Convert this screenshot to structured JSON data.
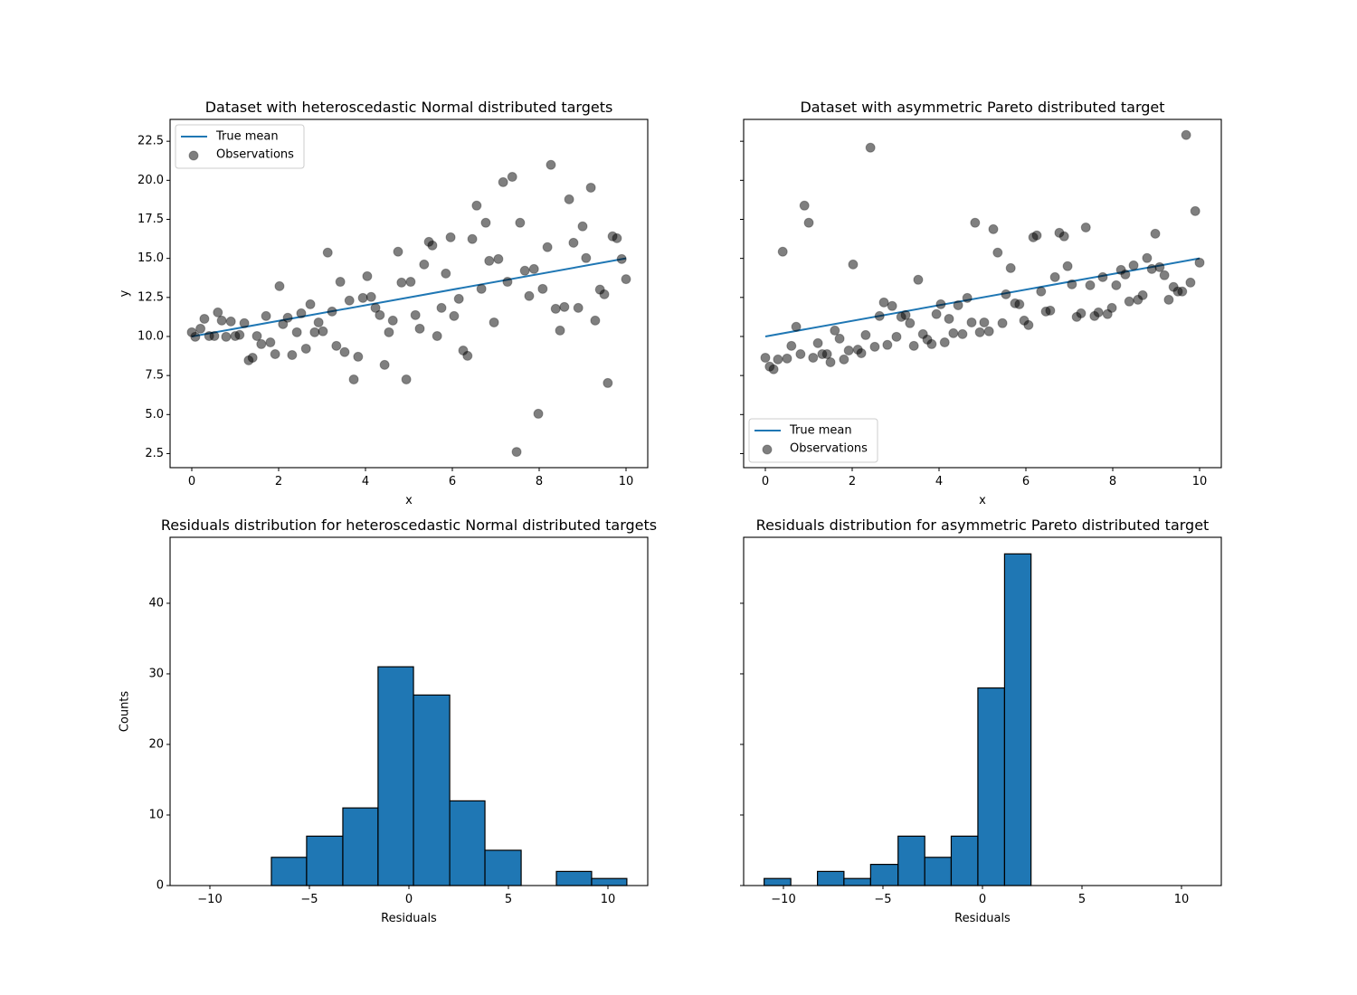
{
  "chart_data": [
    {
      "type": "scatter",
      "title": "Dataset with heteroscedastic Normal distributed targets",
      "xlabel": "x",
      "ylabel": "y",
      "xlim": [
        -0.5,
        10.5
      ],
      "ylim": [
        1.6,
        23.9
      ],
      "xticks": [
        0,
        2,
        4,
        6,
        8,
        10
      ],
      "xtick_labels": [
        "0",
        "2",
        "4",
        "6",
        "8",
        "10"
      ],
      "yticks": [
        2.5,
        5.0,
        7.5,
        10.0,
        12.5,
        15.0,
        17.5,
        20.0,
        22.5
      ],
      "ytick_labels": [
        "2.5",
        "5.0",
        "7.5",
        "10.0",
        "12.5",
        "15.0",
        "17.5",
        "20.0",
        "22.5"
      ],
      "show_ytick_labels": true,
      "legend": {
        "placement": "upper-left",
        "entries": [
          "True mean",
          "Observations"
        ]
      },
      "grid": false,
      "true_mean": {
        "name": "True mean",
        "x": [
          0,
          10
        ],
        "y": [
          10,
          15
        ],
        "color": "#1f77b4"
      },
      "observations": {
        "name": "Observations",
        "color": "#000000",
        "alpha": 0.5,
        "x": [
          0,
          0.08,
          0.2,
          0.29,
          0.4,
          0.52,
          0.6,
          0.69,
          0.79,
          0.9,
          1.0,
          1.1,
          1.21,
          1.31,
          1.4,
          1.5,
          1.6,
          1.71,
          1.81,
          1.92,
          2.02,
          2.1,
          2.21,
          2.31,
          2.42,
          2.52,
          2.63,
          2.73,
          2.83,
          2.92,
          3.02,
          3.13,
          3.23,
          3.33,
          3.42,
          3.52,
          3.63,
          3.73,
          3.83,
          3.94,
          4.04,
          4.13,
          4.23,
          4.33,
          4.44,
          4.54,
          4.63,
          4.75,
          4.83,
          4.94,
          5.04,
          5.15,
          5.25,
          5.35,
          5.46,
          5.54,
          5.65,
          5.75,
          5.85,
          5.96,
          6.04,
          6.15,
          6.25,
          6.35,
          6.46,
          6.56,
          6.67,
          6.77,
          6.85,
          6.96,
          7.06,
          7.17,
          7.27,
          7.38,
          7.48,
          7.56,
          7.67,
          7.77,
          7.88,
          7.98,
          8.08,
          8.19,
          8.27,
          8.38,
          8.48,
          8.58,
          8.69,
          8.79,
          8.9,
          9.0,
          9.08,
          9.19,
          9.29,
          9.4,
          9.5,
          9.58,
          9.69,
          9.79,
          9.9,
          10
        ],
        "y": [
          10.27,
          9.98,
          10.5,
          11.13,
          10.03,
          10.03,
          11.54,
          11.02,
          9.98,
          10.96,
          10.03,
          10.1,
          10.85,
          8.47,
          8.64,
          10.03,
          9.51,
          11.31,
          9.62,
          8.87,
          13.22,
          10.79,
          11.2,
          8.81,
          10.27,
          11.48,
          9.22,
          12.06,
          10.27,
          10.9,
          10.33,
          15.37,
          11.6,
          9.4,
          13.5,
          9.0,
          12.3,
          7.25,
          8.7,
          12.47,
          13.86,
          12.53,
          11.83,
          11.37,
          8.18,
          10.27,
          11.02,
          15.43,
          13.45,
          7.25,
          13.5,
          11.37,
          10.5,
          14.61,
          16.06,
          15.83,
          10.03,
          11.83,
          14.03,
          16.35,
          11.31,
          12.41,
          9.1,
          8.76,
          16.24,
          18.38,
          13.05,
          17.28,
          14.84,
          10.9,
          14.96,
          19.88,
          13.5,
          20.22,
          2.61,
          17.28,
          14.21,
          12.59,
          14.32,
          5.05,
          13.05,
          15.72,
          20.99,
          11.77,
          10.38,
          11.89,
          18.78,
          16.0,
          11.83,
          17.05,
          15.02,
          19.53,
          11.02,
          13.0,
          12.7,
          7.02,
          16.41,
          16.29,
          14.96,
          13.67
        ]
      }
    },
    {
      "type": "scatter",
      "title": "Dataset with asymmetric Pareto distributed target",
      "xlabel": "x",
      "ylabel": "",
      "xlim": [
        -0.5,
        10.5
      ],
      "ylim": [
        1.6,
        23.9
      ],
      "xticks": [
        0,
        2,
        4,
        6,
        8,
        10
      ],
      "xtick_labels": [
        "0",
        "2",
        "4",
        "6",
        "8",
        "10"
      ],
      "yticks": [
        2.5,
        5.0,
        7.5,
        10.0,
        12.5,
        15.0,
        17.5,
        20.0,
        22.5
      ],
      "ytick_labels": [],
      "show_ytick_labels": false,
      "legend": {
        "placement": "lower-left",
        "entries": [
          "True mean",
          "Observations"
        ]
      },
      "grid": false,
      "true_mean": {
        "name": "True mean",
        "x": [
          0,
          10
        ],
        "y": [
          10,
          15
        ],
        "color": "#1f77b4"
      },
      "observations": {
        "name": "Observations",
        "color": "#000000",
        "alpha": 0.5,
        "x": [
          0,
          0.1,
          0.19,
          0.29,
          0.4,
          0.5,
          0.6,
          0.71,
          0.81,
          0.9,
          1.0,
          1.1,
          1.21,
          1.31,
          1.42,
          1.5,
          1.6,
          1.71,
          1.81,
          1.92,
          2.02,
          2.13,
          2.21,
          2.31,
          2.42,
          2.52,
          2.63,
          2.73,
          2.81,
          2.92,
          3.02,
          3.13,
          3.23,
          3.33,
          3.42,
          3.52,
          3.63,
          3.73,
          3.83,
          3.94,
          4.04,
          4.13,
          4.23,
          4.33,
          4.44,
          4.54,
          4.65,
          4.75,
          4.83,
          4.94,
          5.04,
          5.15,
          5.25,
          5.35,
          5.46,
          5.54,
          5.65,
          5.75,
          5.85,
          5.96,
          6.06,
          6.17,
          6.25,
          6.35,
          6.46,
          6.56,
          6.67,
          6.77,
          6.88,
          6.96,
          7.06,
          7.17,
          7.27,
          7.38,
          7.48,
          7.58,
          7.67,
          7.77,
          7.88,
          7.98,
          8.08,
          8.19,
          8.29,
          8.38,
          8.48,
          8.58,
          8.69,
          8.79,
          8.9,
          8.98,
          9.08,
          9.19,
          9.29,
          9.4,
          9.5,
          9.6,
          9.69,
          9.79,
          9.9,
          10
        ],
        "y": [
          8.64,
          8.07,
          7.9,
          8.53,
          15.43,
          8.59,
          9.4,
          10.62,
          8.87,
          18.38,
          17.28,
          8.64,
          9.57,
          8.87,
          8.87,
          8.35,
          10.38,
          9.86,
          8.53,
          9.1,
          14.61,
          9.16,
          8.93,
          10.09,
          22.09,
          9.34,
          11.31,
          12.18,
          9.46,
          11.95,
          9.98,
          11.25,
          11.37,
          10.85,
          9.4,
          13.63,
          10.15,
          9.8,
          9.51,
          11.43,
          12.06,
          9.62,
          11.13,
          10.21,
          12.0,
          10.15,
          12.47,
          10.9,
          17.28,
          10.27,
          10.9,
          10.33,
          16.87,
          15.37,
          10.85,
          12.7,
          14.38,
          12.12,
          12.06,
          11.02,
          10.73,
          16.35,
          16.47,
          12.88,
          11.6,
          11.66,
          13.8,
          16.64,
          16.41,
          14.5,
          13.34,
          11.25,
          11.48,
          16.98,
          13.28,
          11.31,
          11.54,
          13.8,
          11.43,
          11.83,
          13.28,
          14.26,
          13.97,
          12.24,
          14.55,
          12.35,
          12.64,
          15.02,
          14.32,
          16.58,
          14.44,
          13.92,
          12.35,
          13.17,
          12.88,
          12.88,
          22.9,
          13.45,
          18.03,
          14.73
        ]
      }
    },
    {
      "type": "bar",
      "subtype": "histogram",
      "title": "Residuals distribution for heteroscedastic Normal distributed targets",
      "xlabel": "Residuals",
      "ylabel": "Counts",
      "xlim": [
        -12,
        12
      ],
      "ylim": [
        0,
        49.35
      ],
      "xticks": [
        -10,
        -5,
        0,
        5,
        10
      ],
      "xtick_labels": [
        "−10",
        "−5",
        "0",
        "5",
        "10"
      ],
      "yticks": [
        0,
        10,
        20,
        30,
        40
      ],
      "ytick_labels": [
        "0",
        "10",
        "20",
        "30",
        "40"
      ],
      "show_ytick_labels": true,
      "grid": false,
      "color": "#1f77b4",
      "edgecolor": "#000000",
      "bin_edges": [
        -6.91,
        -5.14,
        -3.32,
        -1.55,
        0.23,
        2.05,
        3.82,
        5.64,
        7.41,
        9.18,
        10.95
      ],
      "values": [
        4,
        7,
        11,
        31,
        27,
        12,
        5,
        0,
        2,
        1
      ]
    },
    {
      "type": "bar",
      "subtype": "histogram",
      "title": "Residuals distribution for asymmetric Pareto distributed target",
      "xlabel": "Residuals",
      "ylabel": "",
      "xlim": [
        -12,
        12
      ],
      "ylim": [
        0,
        49.35
      ],
      "xticks": [
        -10,
        -5,
        0,
        5,
        10
      ],
      "xtick_labels": [
        "−10",
        "−5",
        "0",
        "5",
        "10"
      ],
      "yticks": [
        0,
        10,
        20,
        30,
        40
      ],
      "ytick_labels": [],
      "show_ytick_labels": false,
      "grid": false,
      "color": "#1f77b4",
      "edgecolor": "#000000",
      "bin_edges": [
        -10.97,
        -9.63,
        -8.29,
        -6.96,
        -5.62,
        -4.24,
        -2.9,
        -1.57,
        -0.23,
        1.11,
        2.44
      ],
      "values": [
        1,
        0,
        2,
        1,
        3,
        7,
        4,
        7,
        28,
        47
      ]
    }
  ]
}
